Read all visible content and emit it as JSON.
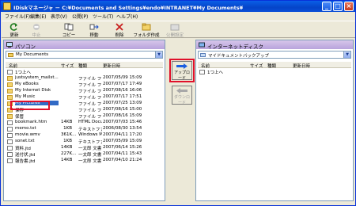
{
  "window": {
    "title": "IDiskマネージャ － C:¥Documents and Settings¥endo¥INTRANET¥My Documents¥"
  },
  "menu": [
    "ファイル(F)",
    "編集(E)",
    "表示(V)",
    "公開(P)",
    "ツール(T)",
    "ヘルプ(H)"
  ],
  "toolbar": [
    {
      "label": "更新",
      "icon": "refresh-icon",
      "enabled": true
    },
    {
      "label": "中止",
      "icon": "stop-icon",
      "enabled": false
    },
    {
      "label": "コピー",
      "icon": "copy-icon",
      "enabled": true
    },
    {
      "label": "移動",
      "icon": "move-icon",
      "enabled": true
    },
    {
      "label": "削除",
      "icon": "delete-icon",
      "enabled": true
    },
    {
      "label": "フォルダ作成",
      "icon": "new-folder-icon",
      "enabled": true
    },
    {
      "label": "公開設定",
      "icon": "publish-settings-icon",
      "enabled": false
    }
  ],
  "left_pane": {
    "title": "パソコン",
    "path": "My Documents",
    "columns": [
      "名前",
      "サイズ",
      "種類",
      "更新日時"
    ],
    "rows": [
      {
        "name": "1つ上へ",
        "size": "",
        "type": "",
        "date": "",
        "icon": "up"
      },
      {
        "name": "justsystem_mailst...",
        "size": "",
        "type": "ファイル フォル...",
        "date": "2007/05/09 15:09",
        "icon": "folder"
      },
      {
        "name": "My eBooks",
        "size": "",
        "type": "ファイル フォル...",
        "date": "2007/07/17 17:49",
        "icon": "folder"
      },
      {
        "name": "My Internet Disk",
        "size": "",
        "type": "ファイル フォル...",
        "date": "2007/08/16 16:06",
        "icon": "folder"
      },
      {
        "name": "My Music",
        "size": "",
        "type": "ファイル フォル...",
        "date": "2007/07/17 17:51",
        "icon": "folder"
      },
      {
        "name": "My Pictures",
        "size": "",
        "type": "ファイル フォル...",
        "date": "2007/07/25 13:09",
        "icon": "folder",
        "selected": true
      },
      {
        "name": "保存",
        "size": "",
        "type": "ファイル フォル...",
        "date": "2007/08/16 15:00",
        "icon": "folder"
      },
      {
        "name": "保管",
        "size": "",
        "type": "ファイル フォル...",
        "date": "2007/08/16 15:09",
        "icon": "folder"
      },
      {
        "name": "bookmark.htm",
        "size": "14KB",
        "type": "HTML Docu...",
        "date": "2007/07/03 15:46",
        "icon": "file"
      },
      {
        "name": "memo.txt",
        "size": "1KB",
        "type": "テキストファイル",
        "date": "2006/08/30 13:54",
        "icon": "file"
      },
      {
        "name": "movie.wmv",
        "size": "361K...",
        "type": "Windows Me...",
        "date": "2007/04/11 17:20",
        "icon": "file"
      },
      {
        "name": "sonet.txt",
        "size": "1KB",
        "type": "テキストファイル",
        "date": "2007/05/09 15:09",
        "icon": "file"
      },
      {
        "name": "資料.jtd",
        "size": "14KB",
        "type": "一太郎 文書",
        "date": "2007/06/14 15:26",
        "icon": "file"
      },
      {
        "name": "送付状.jtd",
        "size": "227K...",
        "type": "一太郎 文書",
        "date": "2007/04/11 15:43",
        "icon": "file"
      },
      {
        "name": "報告書.jtd",
        "size": "14KB",
        "type": "一太郎 文書",
        "date": "2007/04/10 21:24",
        "icon": "file"
      }
    ]
  },
  "right_pane": {
    "title": "インターネットディスク",
    "path": "マイドキュメントバックアップ",
    "columns": [
      "名前",
      "サイズ",
      "種類",
      "更新日時"
    ],
    "rows": [
      {
        "name": "1つ上へ",
        "icon": "up"
      }
    ]
  },
  "transfer": {
    "upload_label": "アップロード",
    "download_label": "ダウンロード"
  },
  "colors": {
    "titlebar": "#0a5fe8",
    "pane_header": "#c4b0e2",
    "highlight": "#e0102a",
    "selection": "#316ac5"
  }
}
